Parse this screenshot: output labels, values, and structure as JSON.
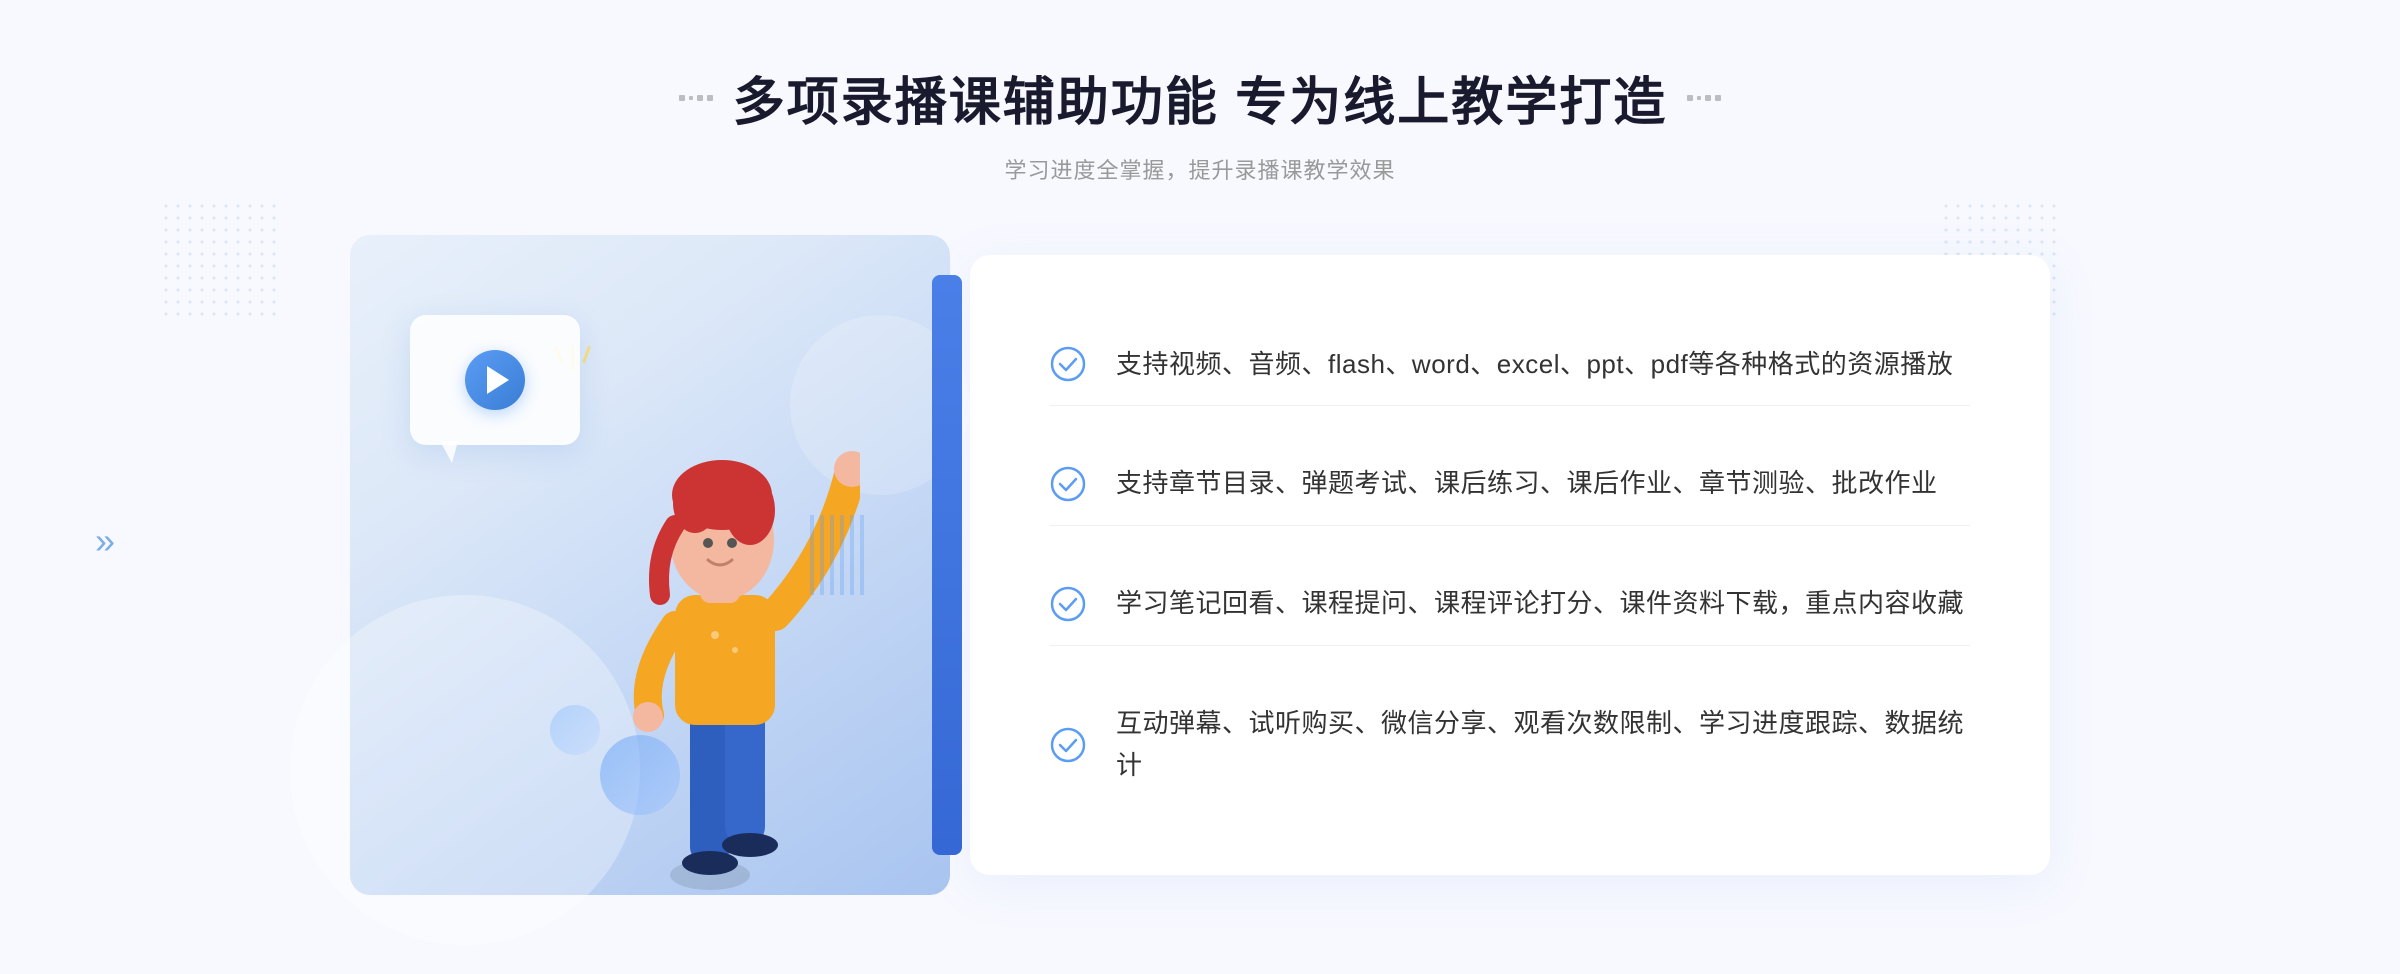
{
  "page": {
    "title": "多项录播课辅助功能 专为线上教学打造",
    "subtitle": "学习进度全掌握，提升录播课教学效果",
    "title_decorator_left": "decorator",
    "title_decorator_right": "decorator"
  },
  "features": [
    {
      "id": 1,
      "text": "支持视频、音频、flash、word、excel、ppt、pdf等各种格式的资源播放"
    },
    {
      "id": 2,
      "text": "支持章节目录、弹题考试、课后练习、课后作业、章节测验、批改作业"
    },
    {
      "id": 3,
      "text": "学习笔记回看、课程提问、课程评论打分、课件资料下载，重点内容收藏"
    },
    {
      "id": 4,
      "text": "互动弹幕、试听购买、微信分享、观看次数限制、学习进度跟踪、数据统计"
    }
  ],
  "colors": {
    "primary_blue": "#4a7fe8",
    "accent_blue": "#5b9df5",
    "text_dark": "#1a1a2e",
    "text_gray": "#999999",
    "text_body": "#333333",
    "check_color": "#5b9df5",
    "bg_light": "#f8f9ff"
  },
  "illustration": {
    "play_button_alt": "视频播放按钮",
    "character_alt": "教学人物插图"
  },
  "arrows": {
    "left_arrow": "»"
  }
}
